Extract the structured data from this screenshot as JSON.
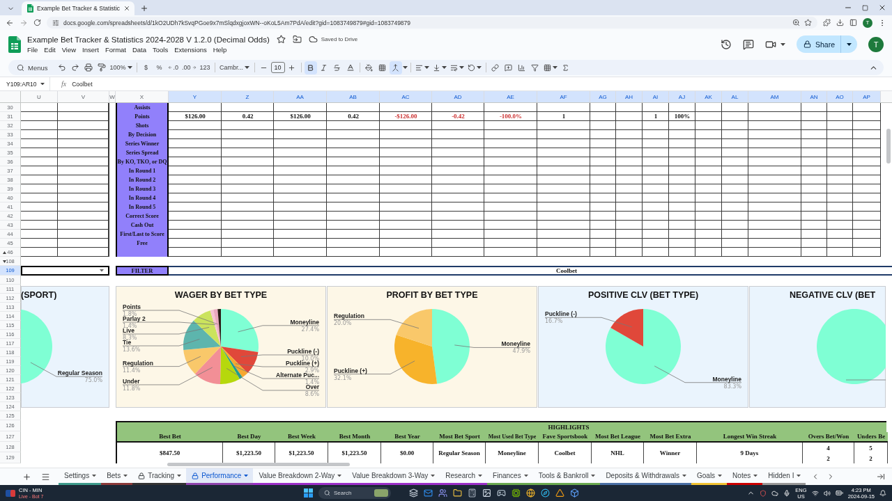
{
  "browser": {
    "tab_title": "Example Bet Tracker & Statistic",
    "url": "docs.google.com/spreadsheets/d/1kO2UDh7kSvqPGoe9x7mSlqdxgjoxWN--oKoL5Am7PdA/edit?gid=1083749879#gid=1083749879",
    "profile_initial": "T"
  },
  "app_header": {
    "title": "Example Bet Tracker & Statistics 2024-2028 V 1.2.0 (Decimal Odds)",
    "save_status": "Saved to Drive",
    "menu": [
      "File",
      "Edit",
      "View",
      "Insert",
      "Format",
      "Data",
      "Tools",
      "Extensions",
      "Help"
    ],
    "share": "Share",
    "avatar_initial": "T"
  },
  "toolbar": {
    "search": "Menus",
    "zoom": "100%",
    "currency": "$",
    "percent": "%",
    "decimal_less": ".0",
    "decimal_more": ".00",
    "number_formats": "123",
    "font": "Cambr...",
    "font_size": "10",
    "bold": true,
    "italic": false,
    "strikethrough": false,
    "merged": true
  },
  "formula_bar": {
    "name_box": "Y109:AR10",
    "function_symbol": "fx",
    "content": "Coolbet"
  },
  "sheet": {
    "columns": [
      {
        "label": "U",
        "selected": false
      },
      {
        "label": "V",
        "selected": false
      },
      {
        "label": "W",
        "selected": false
      },
      {
        "label": "X",
        "selected": false
      },
      {
        "label": "Y",
        "selected": true
      },
      {
        "label": "Z",
        "selected": true
      },
      {
        "label": "AA",
        "selected": true
      },
      {
        "label": "AB",
        "selected": true
      },
      {
        "label": "AC",
        "selected": true
      },
      {
        "label": "AD",
        "selected": true
      },
      {
        "label": "AE",
        "selected": true
      },
      {
        "label": "AF",
        "selected": true
      },
      {
        "label": "AG",
        "selected": true
      },
      {
        "label": "AH",
        "selected": true
      },
      {
        "label": "AI",
        "selected": true
      },
      {
        "label": "AJ",
        "selected": true
      },
      {
        "label": "AK",
        "selected": true
      },
      {
        "label": "AL",
        "selected": true
      },
      {
        "label": "AM",
        "selected": true
      },
      {
        "label": "AN",
        "selected": true
      },
      {
        "label": "AO",
        "selected": true
      },
      {
        "label": "AP",
        "selected": true
      }
    ],
    "rows": [
      {
        "number": "30",
        "label": "Assists",
        "group_toggle": false
      },
      {
        "number": "31",
        "label": "Points",
        "group_toggle": false,
        "cells": [
          {
            "text": "$126.00",
            "negative": false
          },
          {
            "text": "0.42",
            "negative": false
          },
          {
            "text": "$126.00",
            "negative": false
          },
          {
            "text": "0.42",
            "negative": false
          },
          {
            "text": "-$126.00",
            "negative": true
          },
          {
            "text": "-0.42",
            "negative": true
          },
          {
            "text": "-100.0%",
            "negative": true
          },
          {
            "text": "1",
            "negative": false
          },
          null,
          null,
          {
            "text": "1",
            "negative": false
          },
          {
            "text": "100%",
            "negative": false
          }
        ]
      },
      {
        "number": "32",
        "label": "Shots",
        "group_toggle": false
      },
      {
        "number": "33",
        "label": "By Decision",
        "group_toggle": false
      },
      {
        "number": "34",
        "label": "Series Winner",
        "group_toggle": false
      },
      {
        "number": "35",
        "label": "Series Spread",
        "group_toggle": false
      },
      {
        "number": "36",
        "label": "By KO, TKO, or DQ",
        "group_toggle": false
      },
      {
        "number": "37",
        "label": "In Round 1",
        "group_toggle": false
      },
      {
        "number": "38",
        "label": "In Round 2",
        "group_toggle": false
      },
      {
        "number": "39",
        "label": "In Round 3",
        "group_toggle": false
      },
      {
        "number": "40",
        "label": "In Round 4",
        "group_toggle": false
      },
      {
        "number": "41",
        "label": "In Round 5",
        "group_toggle": false
      },
      {
        "number": "42",
        "label": "Correct Score",
        "group_toggle": false
      },
      {
        "number": "43",
        "label": "Cash Out",
        "group_toggle": false
      },
      {
        "number": "44",
        "label": "First/Last to Score",
        "group_toggle": false
      },
      {
        "number": "45",
        "label": "Free",
        "group_toggle": false
      },
      {
        "number": "46",
        "group_toggle": true
      }
    ],
    "collapsed_row": {
      "number": "108",
      "group_toggle": true
    },
    "filter_row": {
      "number": "109",
      "selected": true,
      "label": "FILTER",
      "value": "Coolbet"
    },
    "lower_rows": [
      "110",
      "111",
      "112",
      "113",
      "114",
      "115",
      "116",
      "117",
      "118",
      "119",
      "120",
      "121",
      "122",
      "123",
      "124",
      "125",
      "126",
      "127",
      "128",
      "129"
    ]
  },
  "charts": [
    {
      "color": "#eaf4fd",
      "chart_data": {
        "type": "pie",
        "title": "(SPORT)",
        "categories": [
          "Regular Season"
        ],
        "values": [
          75.0
        ],
        "colors": [
          "#7fffd4"
        ],
        "value_labels": [
          "75.0%"
        ]
      }
    },
    {
      "color": "#fdf7e7",
      "chart_data": {
        "type": "pie",
        "title": "WAGER BY BET TYPE",
        "categories": [
          "Moneyline",
          "Puckline (-)",
          "Puckline (+)",
          "Alternate Puc...",
          "Over",
          "Under",
          "Regulation",
          "Tie",
          "Live",
          "Parlay 2",
          "Points",
          null
        ],
        "values": [
          27.4,
          10.0,
          2.9,
          1.4,
          8.6,
          11.8,
          11.4,
          13.6,
          8.3,
          1.4,
          1.8,
          1.4
        ],
        "colors": [
          "#7fffd4",
          "#e0483a",
          "#f6a830",
          "#1e9e8f",
          "#b6d80c",
          "#f28f96",
          "#f9c86a",
          "#5db5ad",
          "#cbe35d",
          "#f7c4d2",
          "#eaa8bf",
          "#2b1d16"
        ],
        "value_labels": [
          "27.4%",
          "10.0%",
          "2.9%",
          "1.4%",
          "8.6%",
          "11.8%",
          "11.4%",
          "13.6%",
          "8.3%",
          "1.4%",
          "1.8%",
          null
        ]
      }
    },
    {
      "color": "#fdf7e7",
      "chart_data": {
        "type": "pie",
        "title": "PROFIT BY BET TYPE",
        "categories": [
          "Moneyline",
          "Puckline (+)",
          "Regulation"
        ],
        "values": [
          47.9,
          32.1,
          20.0
        ],
        "colors": [
          "#7fffd4",
          "#f7b32b",
          "#f9c86a"
        ],
        "value_labels": [
          "47.9%",
          "32.1%",
          "20.0%"
        ]
      }
    },
    {
      "color": "#eaf4fd",
      "chart_data": {
        "type": "pie",
        "title": "POSITIVE CLV (BET TYPE)",
        "categories": [
          "Moneyline",
          "Puckline (-)"
        ],
        "values": [
          83.3,
          16.7
        ],
        "colors": [
          "#7fffd4",
          "#e0483a"
        ],
        "value_labels": [
          "83.3%",
          "16.7%"
        ]
      }
    },
    {
      "color": "#eaf4fd",
      "title": "NEGATIVE CLV (BET"
    }
  ],
  "highlights": {
    "title": "HIGHLIGHTS",
    "columns": [
      {
        "label": "Best Bet",
        "values": [
          "$847.50"
        ]
      },
      {
        "label": "Best Day",
        "values": [
          "$1,223.50"
        ]
      },
      {
        "label": "Best Week",
        "values": [
          "$1,223.50"
        ]
      },
      {
        "label": "Best Month",
        "values": [
          "$1,223.50"
        ]
      },
      {
        "label": "Best Year",
        "values": [
          "$0.00"
        ]
      },
      {
        "label": "Most Bet Sport",
        "values": [
          "Regular Season"
        ]
      },
      {
        "label": "Most Used Bet Type",
        "values": [
          "Moneyline"
        ]
      },
      {
        "label": "Fave Sportsbook",
        "values": [
          "Coolbet"
        ]
      },
      {
        "label": "Most Bet League",
        "values": [
          "NHL"
        ]
      },
      {
        "label": "Most Bet Extra",
        "values": [
          "Winner"
        ]
      },
      {
        "label": "Longest Win Streak",
        "values": [
          "9 Days"
        ]
      },
      {
        "label": "Overs Bet/Won",
        "values": [
          "4",
          "2"
        ]
      },
      {
        "label": "Unders Be",
        "values": [
          "5",
          "2"
        ]
      }
    ]
  },
  "sheet_tabs": [
    {
      "label": "Settings",
      "locked": false,
      "selected": false,
      "color": "#3d9a8b"
    },
    {
      "label": "Bets",
      "locked": false,
      "selected": false,
      "color": "#8b3a3a"
    },
    {
      "label": "Tracking",
      "locked": true,
      "selected": false,
      "color": "#333333"
    },
    {
      "label": "Performance",
      "locked": true,
      "selected": true,
      "color": "#8e44ad"
    },
    {
      "label": "Value Breakdown 2-Way",
      "locked": false,
      "selected": false,
      "color": "#9b30c8"
    },
    {
      "label": "Value Breakdown 3-Way",
      "locked": false,
      "selected": false,
      "color": "#9b30c8"
    },
    {
      "label": "Research",
      "locked": false,
      "selected": false,
      "color": "#9b30c8"
    },
    {
      "label": "Finances",
      "locked": false,
      "selected": false,
      "color": "#6aa84f"
    },
    {
      "label": "Tools & Bankroll",
      "locked": false,
      "selected": false,
      "color": "#6aa84f"
    },
    {
      "label": "Deposits & Withdrawals",
      "locked": false,
      "selected": false,
      "color": "#4a6fa5"
    },
    {
      "label": "Goals",
      "locked": false,
      "selected": false,
      "color": "#f1c232"
    },
    {
      "label": "Notes",
      "locked": false,
      "selected": false,
      "color": "#cc0000"
    },
    {
      "label": "Hidden I",
      "locked": false,
      "selected": false,
      "color": "#999999"
    }
  ],
  "taskbar": {
    "widget_title": "CIN - MIN",
    "widget_status": "Live - Bot 7",
    "search": "Search",
    "language": "ENG",
    "region": "US",
    "time": "4:23 PM",
    "date": "2024-09-15"
  }
}
